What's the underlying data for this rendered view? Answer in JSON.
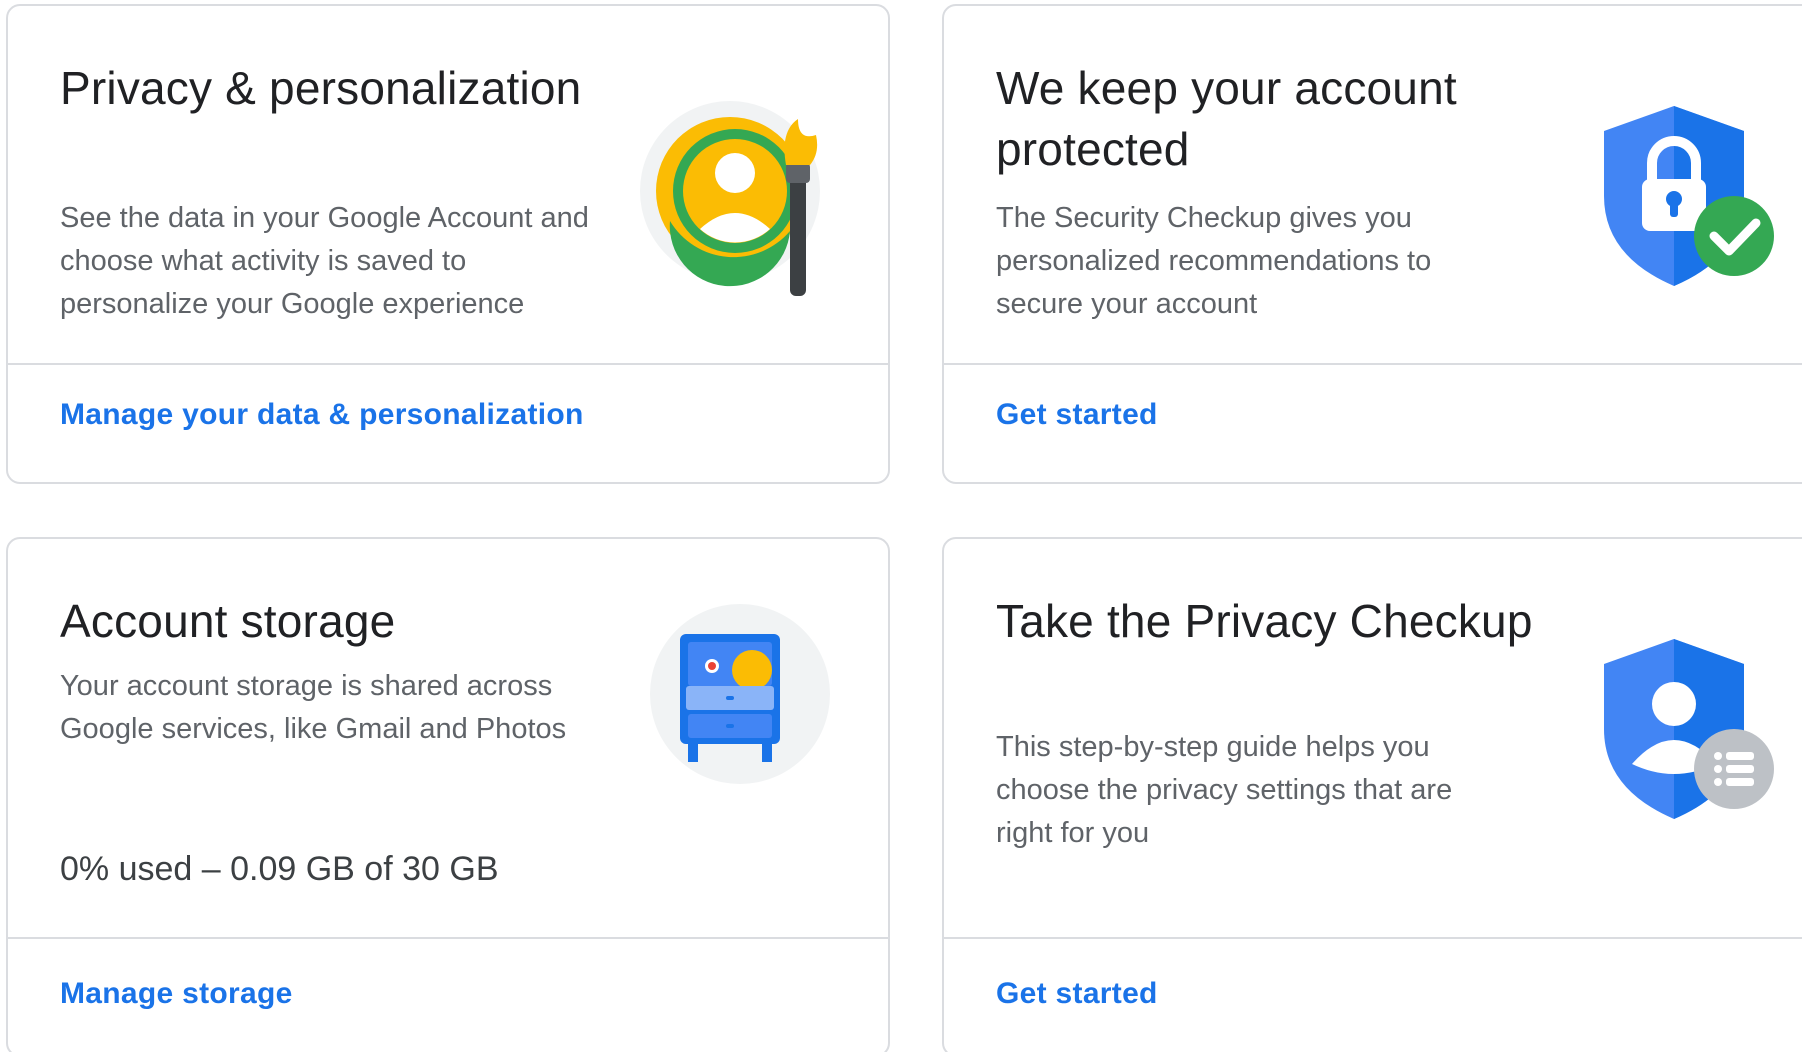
{
  "cards": [
    {
      "title": "Privacy & personalization",
      "description": "See the data in your Google Account and choose what activity is saved to personalize your Google experience",
      "link": "Manage your data & personalization",
      "illustration_icon": "privacy-personalization-icon"
    },
    {
      "title": "We keep your account protected",
      "description": "The Security Checkup gives you personalized recommendations to secure your account",
      "link": "Get started",
      "illustration_icon": "security-shield-check-icon"
    },
    {
      "title": "Account storage",
      "description": "Your account storage is shared across Google services, like Gmail and Photos",
      "usage": "0% used – 0.09 GB of 30 GB",
      "usage_fraction": 0.0,
      "link": "Manage storage",
      "illustration_icon": "storage-cabinet-icon"
    },
    {
      "title": "Take the Privacy Checkup",
      "description": "This step-by-step guide helps you choose the privacy settings that are right for you",
      "link": "Get started",
      "illustration_icon": "privacy-checkup-shield-icon"
    }
  ],
  "colors": {
    "link": "#1a73e8",
    "title": "#202124",
    "text": "#5f6368",
    "border": "#dadce0",
    "google_blue": "#4285f4",
    "google_green": "#34a853",
    "google_yellow": "#fbbc04",
    "google_grey": "#bdc1c6"
  }
}
